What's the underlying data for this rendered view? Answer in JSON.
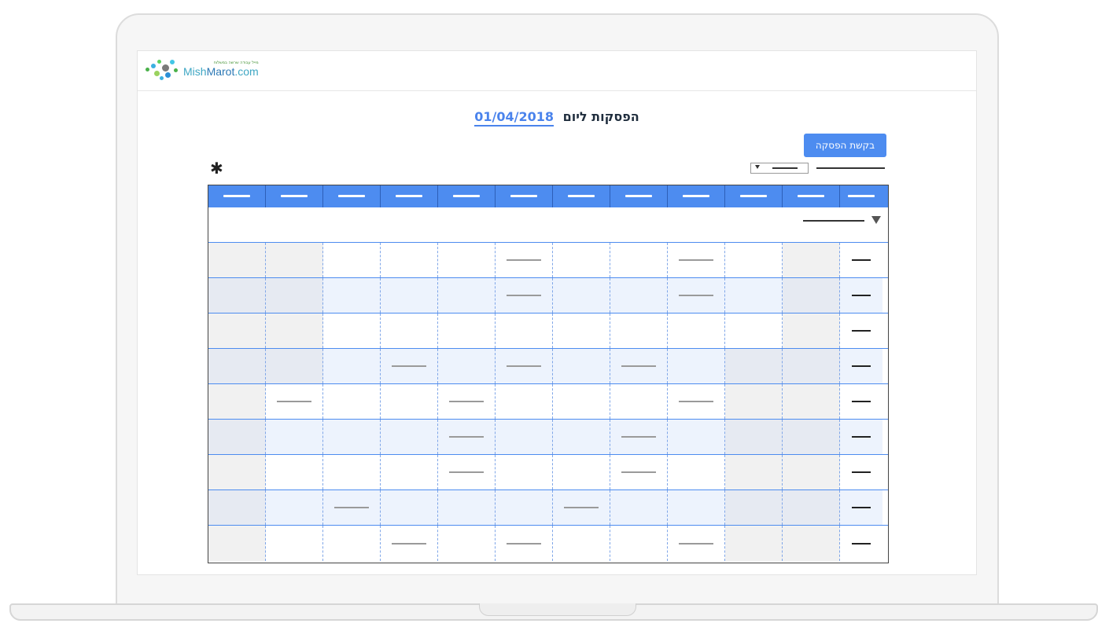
{
  "app": {
    "logo_text_a": "Mish",
    "logo_text_b": "Marot",
    "logo_text_c": ".com",
    "logo_tagline": "מייל עבודה שרשה במשלוח"
  },
  "page": {
    "title": "הפסקות ליום",
    "date": "01/04/2018"
  },
  "toolbar": {
    "request_button_label": "בקשת הפסקה"
  },
  "table": {
    "row_count": 9,
    "column_count": 12
  },
  "colors": {
    "accent": "#4d8cf0",
    "header_bg": "#4d8cf0",
    "title_text": "#1f2d3d"
  }
}
